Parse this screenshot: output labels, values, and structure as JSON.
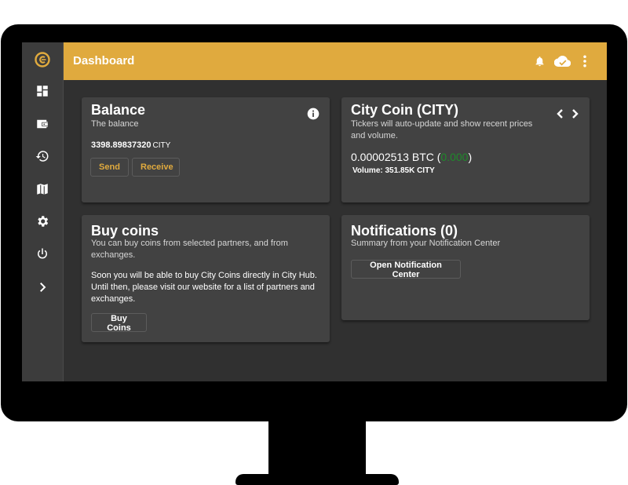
{
  "app": {
    "title": "Dashboard"
  },
  "sidebar": {
    "items": [
      {
        "icon": "dashboard-icon"
      },
      {
        "icon": "wallet-icon"
      },
      {
        "icon": "history-icon"
      },
      {
        "icon": "map-icon"
      },
      {
        "icon": "gear-icon"
      },
      {
        "icon": "power-icon"
      },
      {
        "icon": "chevron-right-icon"
      }
    ]
  },
  "header": {
    "icons": [
      "bell-icon",
      "cloud-check-icon",
      "more-vertical-icon"
    ]
  },
  "balance_card": {
    "title": "Balance",
    "subtitle": "The balance",
    "amount": "3398.89837320",
    "unit": "CITY",
    "send_label": "Send",
    "receive_label": "Receive"
  },
  "ticker_card": {
    "title": "City Coin (CITY)",
    "subtitle": "Tickers will auto-update and show recent prices and volume.",
    "price": "0.00002513 BTC (",
    "change": "0.000",
    "price_close": ")",
    "volume": "Volume: 351.85K CITY"
  },
  "buy_card": {
    "title": "Buy coins",
    "subtitle": "You can buy coins from selected partners, and from exchanges.",
    "body": "Soon you will be able to buy City Coins directly in City Hub. Until then, please visit our website for a list of partners and exchanges.",
    "button_label": "Buy Coins"
  },
  "notifications_card": {
    "title": "Notifications (0)",
    "subtitle": "Summary from your Notification Center",
    "button_label": "Open Notification Center"
  },
  "colors": {
    "accent": "#e0aa3e",
    "background": "#303030",
    "card": "#424242",
    "sidebar": "#3c3c3c",
    "positive": "#1f8a2b"
  }
}
